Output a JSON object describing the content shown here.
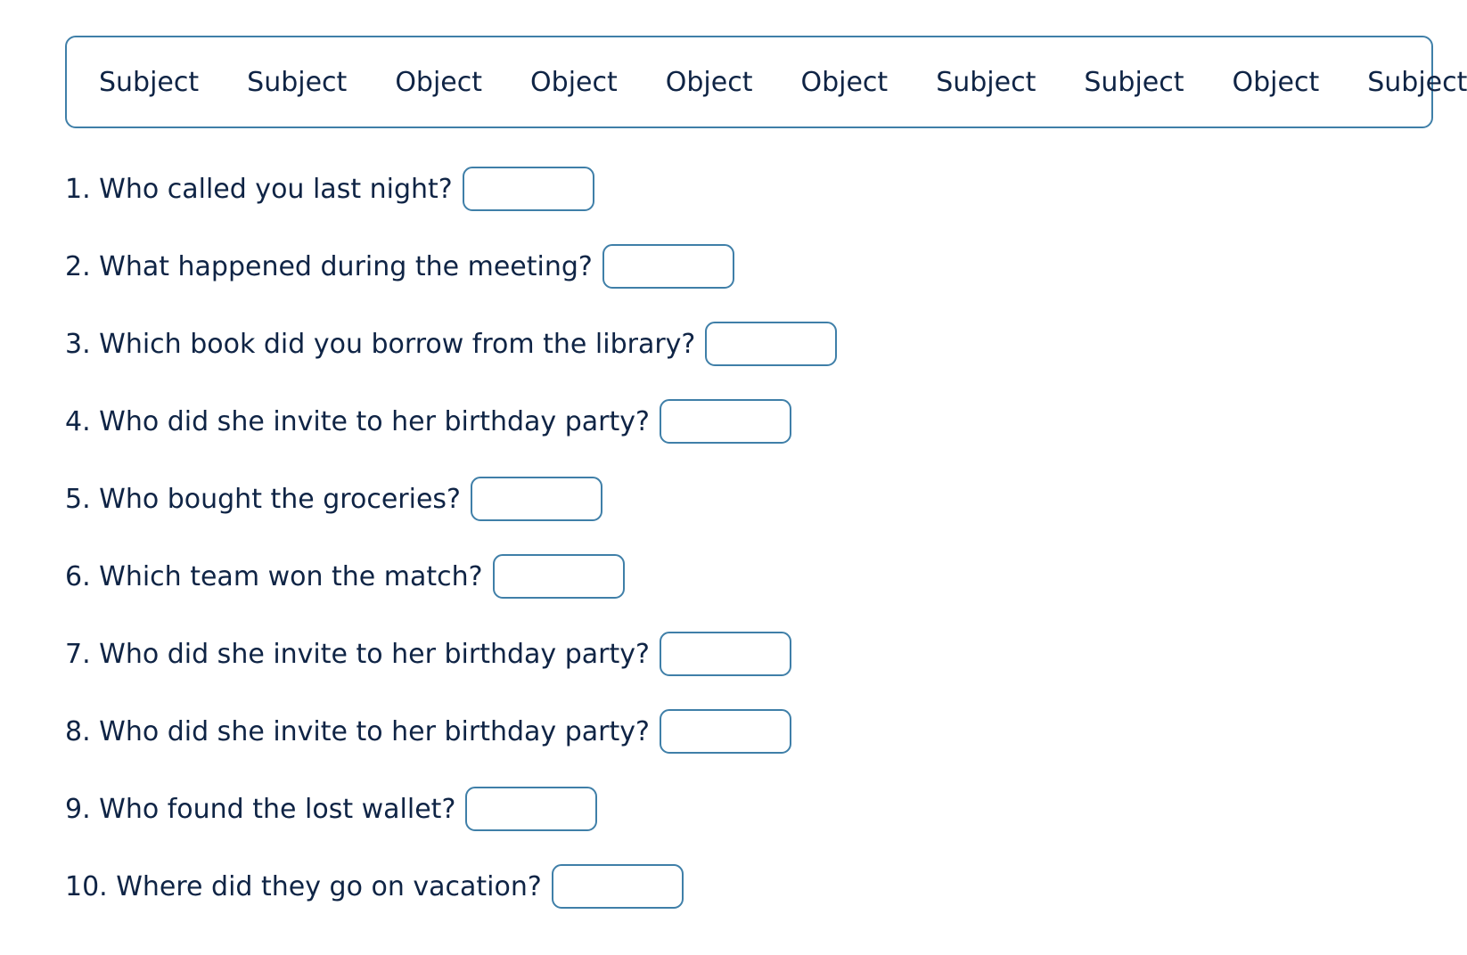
{
  "word_bank": {
    "words": [
      "Subject",
      "Subject",
      "Object",
      "Object",
      "Object",
      "Object",
      "Subject",
      "Subject",
      "Object",
      "Subject"
    ]
  },
  "questions": [
    {
      "text": "1. Who called you last night?",
      "answer": ""
    },
    {
      "text": "2. What happened during the meeting?",
      "answer": ""
    },
    {
      "text": "3. Which book did you borrow from the library?",
      "answer": ""
    },
    {
      "text": "4. Who did she invite to her birthday party?",
      "answer": ""
    },
    {
      "text": "5. Who bought the groceries?",
      "answer": ""
    },
    {
      "text": "6. Which team won the match?",
      "answer": ""
    },
    {
      "text": "7. Who did she invite to her birthday party?",
      "answer": ""
    },
    {
      "text": "8. Who did she invite to her birthday party?",
      "answer": ""
    },
    {
      "text": "9. Who found the lost wallet?",
      "answer": ""
    },
    {
      "text": "10. Where did they go on vacation?",
      "answer": ""
    }
  ],
  "colors": {
    "border": "#3f7fa8",
    "text": "#0f2445"
  }
}
